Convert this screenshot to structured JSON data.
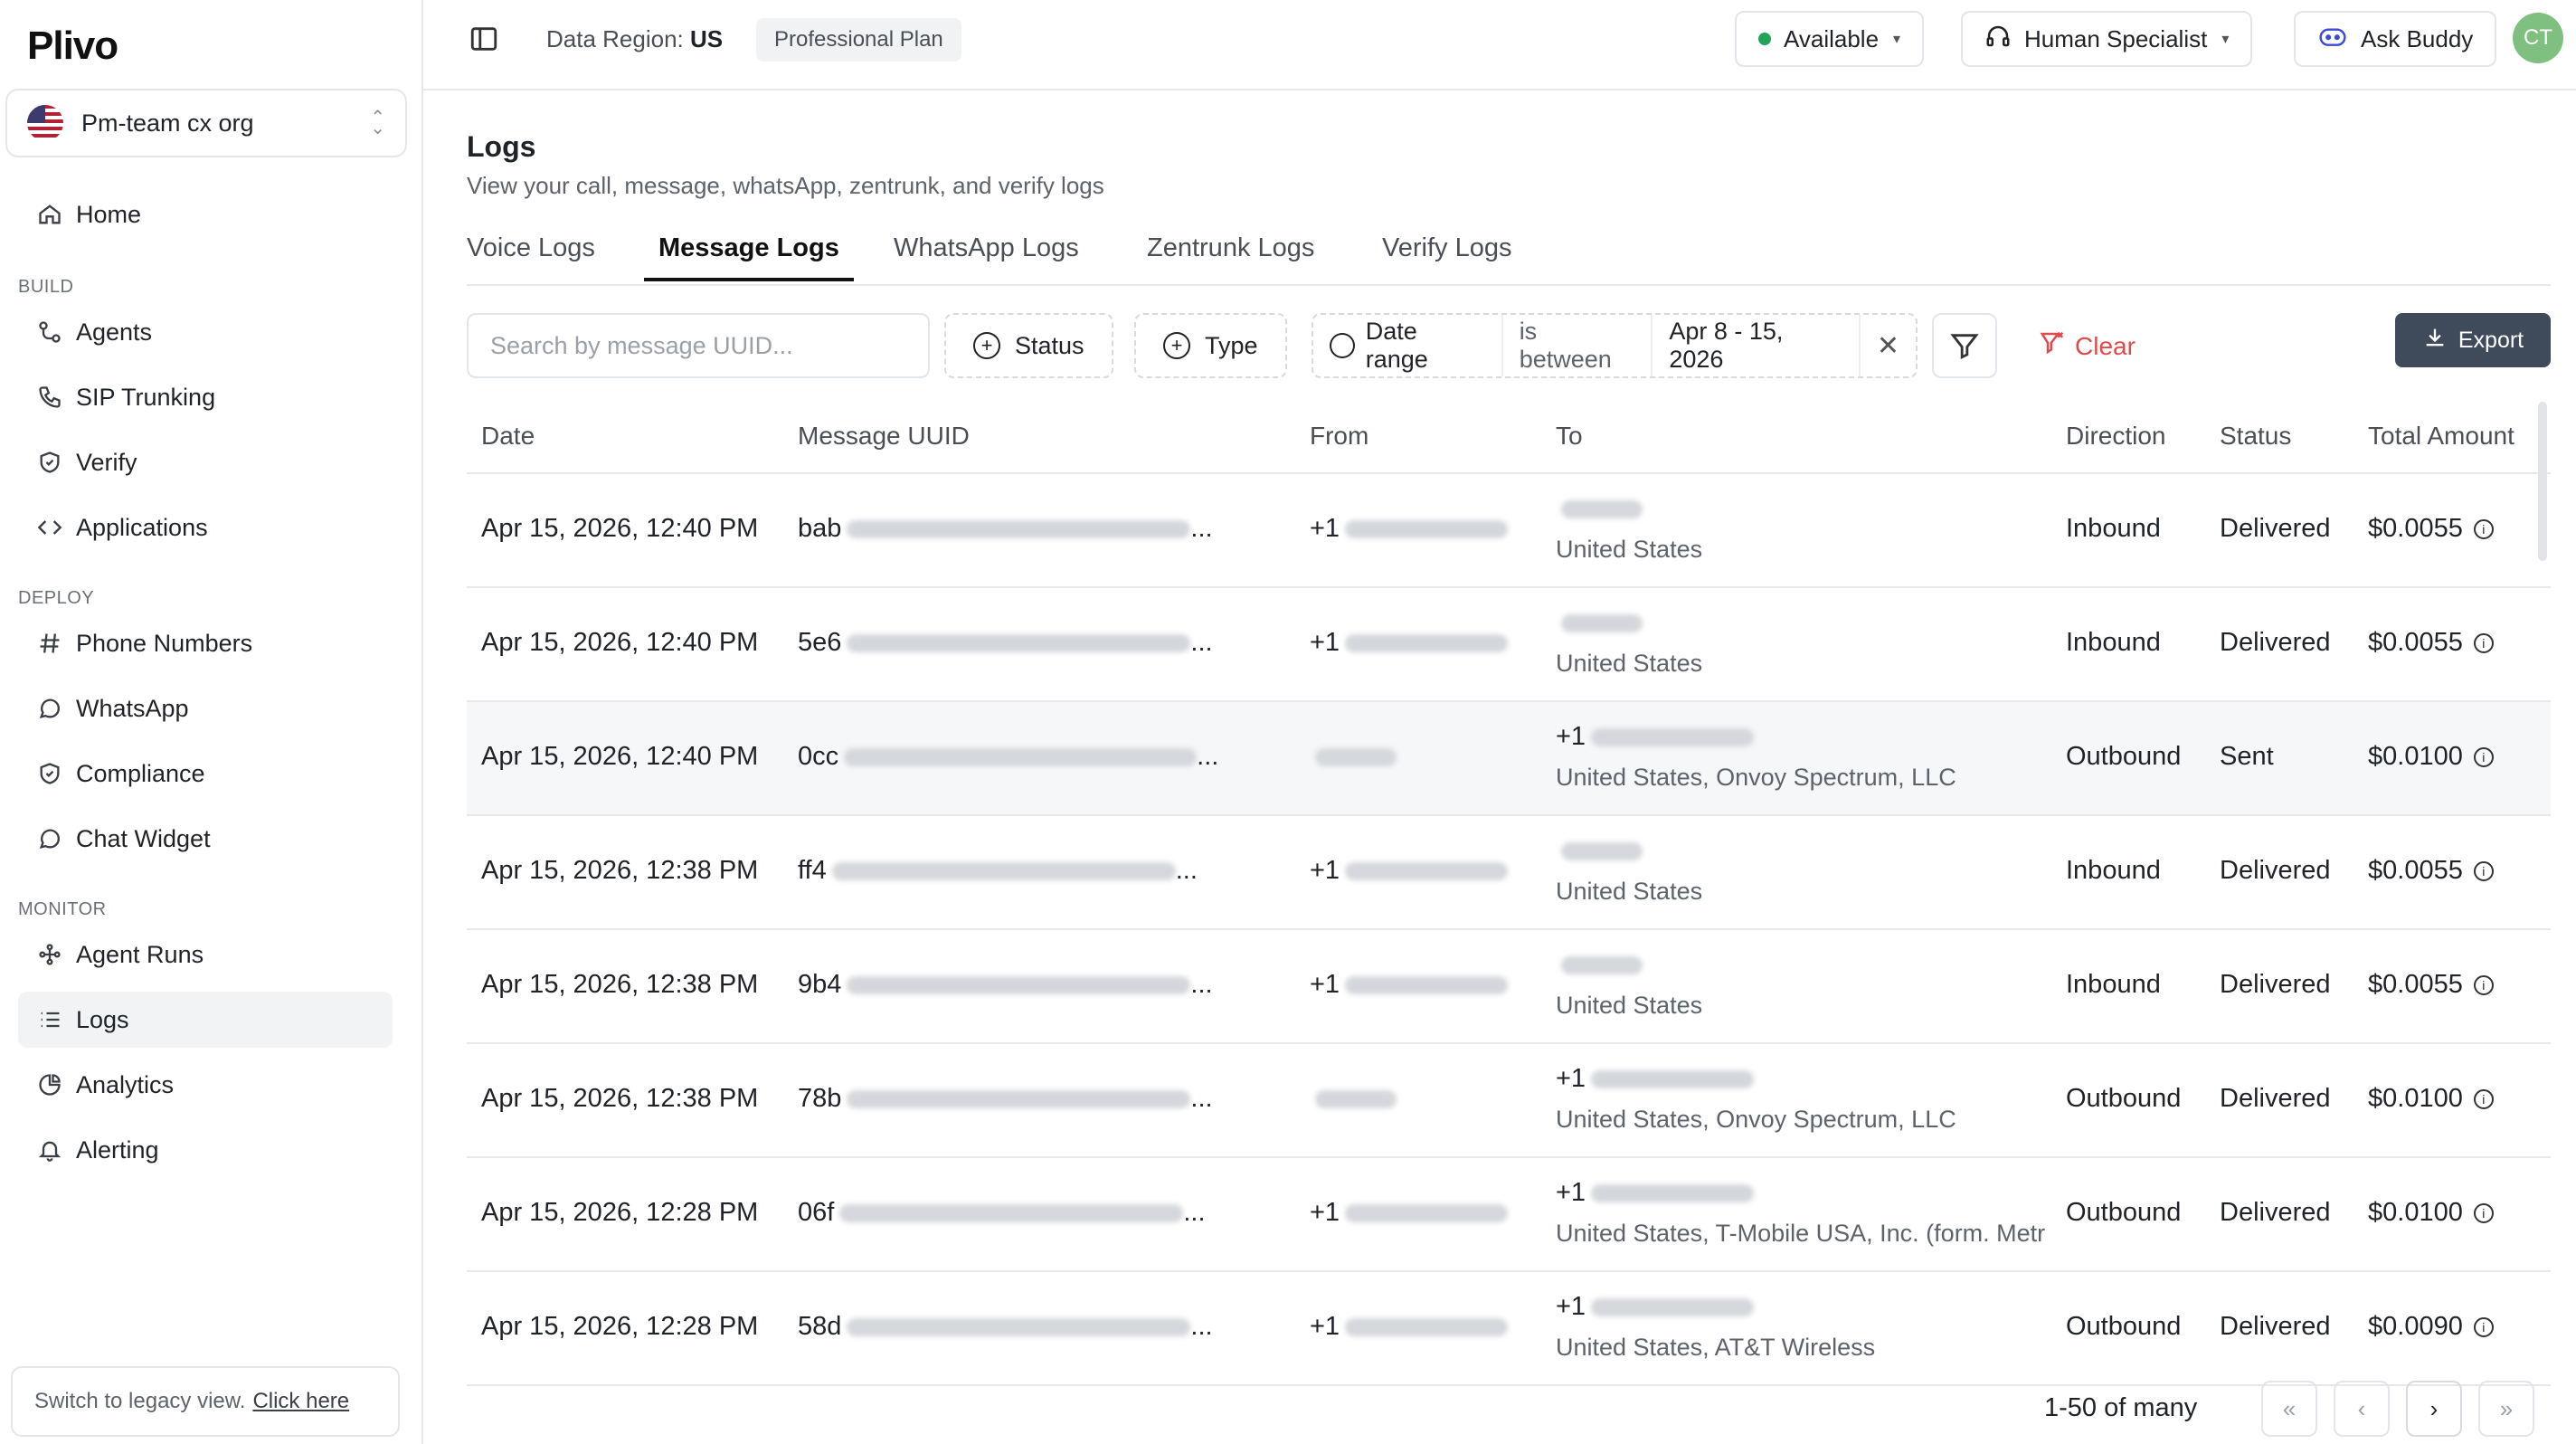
{
  "brand": {
    "logo_text": "Plivo"
  },
  "org": {
    "name": "Pm-team cx org"
  },
  "sidebar": {
    "home": "Home",
    "sections": {
      "build": "BUILD",
      "deploy": "DEPLOY",
      "monitor": "MONITOR"
    },
    "build_items": [
      "Agents",
      "SIP Trunking",
      "Verify",
      "Applications"
    ],
    "deploy_items": [
      "Phone Numbers",
      "WhatsApp",
      "Compliance",
      "Chat Widget"
    ],
    "monitor_items": [
      "Agent Runs",
      "Logs",
      "Analytics",
      "Alerting"
    ],
    "legacy_text": "Switch to legacy view.",
    "legacy_link": "Click here"
  },
  "topbar": {
    "region_label": "Data Region:",
    "region_value": "US",
    "plan": "Professional Plan",
    "status": "Available",
    "specialist": "Human Specialist",
    "ask": "Ask Buddy",
    "avatar": "CT"
  },
  "page": {
    "title": "Logs",
    "subtitle": "View your call, message, whatsApp, zentrunk, and verify logs",
    "tabs": [
      "Voice Logs",
      "Message Logs",
      "WhatsApp Logs",
      "Zentrunk Logs",
      "Verify Logs"
    ]
  },
  "filters": {
    "search_placeholder": "Search by message UUID...",
    "status": "Status",
    "type": "Type",
    "date_range": "Date range",
    "operator": "is between",
    "date_value": "Apr 8 - 15, 2026",
    "clear": "Clear",
    "export": "Export"
  },
  "table": {
    "headers": [
      "Date",
      "Message UUID",
      "From",
      "To",
      "Direction",
      "Status",
      "Total Amount"
    ],
    "rows": [
      {
        "date": "Apr 15, 2026, 12:40 PM",
        "uuid": "bab",
        "from": "+1",
        "to_top": "",
        "to_sub": "United States",
        "direction": "Inbound",
        "status": "Delivered",
        "amount": "$0.0055"
      },
      {
        "date": "Apr 15, 2026, 12:40 PM",
        "uuid": "5e6",
        "from": "+1",
        "to_top": "",
        "to_sub": "United States",
        "direction": "Inbound",
        "status": "Delivered",
        "amount": "$0.0055"
      },
      {
        "date": "Apr 15, 2026, 12:40 PM",
        "uuid": "0cc",
        "from": "",
        "to_top": "+1",
        "to_sub": "United States, Onvoy Spectrum, LLC",
        "direction": "Outbound",
        "status": "Sent",
        "amount": "$0.0100"
      },
      {
        "date": "Apr 15, 2026, 12:38 PM",
        "uuid": "ff4",
        "from": "+1",
        "to_top": "",
        "to_sub": "United States",
        "direction": "Inbound",
        "status": "Delivered",
        "amount": "$0.0055"
      },
      {
        "date": "Apr 15, 2026, 12:38 PM",
        "uuid": "9b4",
        "from": "+1",
        "to_top": "",
        "to_sub": "United States",
        "direction": "Inbound",
        "status": "Delivered",
        "amount": "$0.0055"
      },
      {
        "date": "Apr 15, 2026, 12:38 PM",
        "uuid": "78b",
        "from": "",
        "to_top": "+1",
        "to_sub": "United States, Onvoy Spectrum, LLC",
        "direction": "Outbound",
        "status": "Delivered",
        "amount": "$0.0100"
      },
      {
        "date": "Apr 15, 2026, 12:28 PM",
        "uuid": "06f",
        "from": "+1",
        "to_top": "+1",
        "to_sub": "United States, T-Mobile USA, Inc. (form. Metr",
        "direction": "Outbound",
        "status": "Delivered",
        "amount": "$0.0100"
      },
      {
        "date": "Apr 15, 2026, 12:28 PM",
        "uuid": "58d",
        "from": "+1",
        "to_top": "+1",
        "to_sub": "United States, AT&T Wireless",
        "direction": "Outbound",
        "status": "Delivered",
        "amount": "$0.0090"
      }
    ]
  },
  "pagination": {
    "text": "1-50 of many"
  }
}
